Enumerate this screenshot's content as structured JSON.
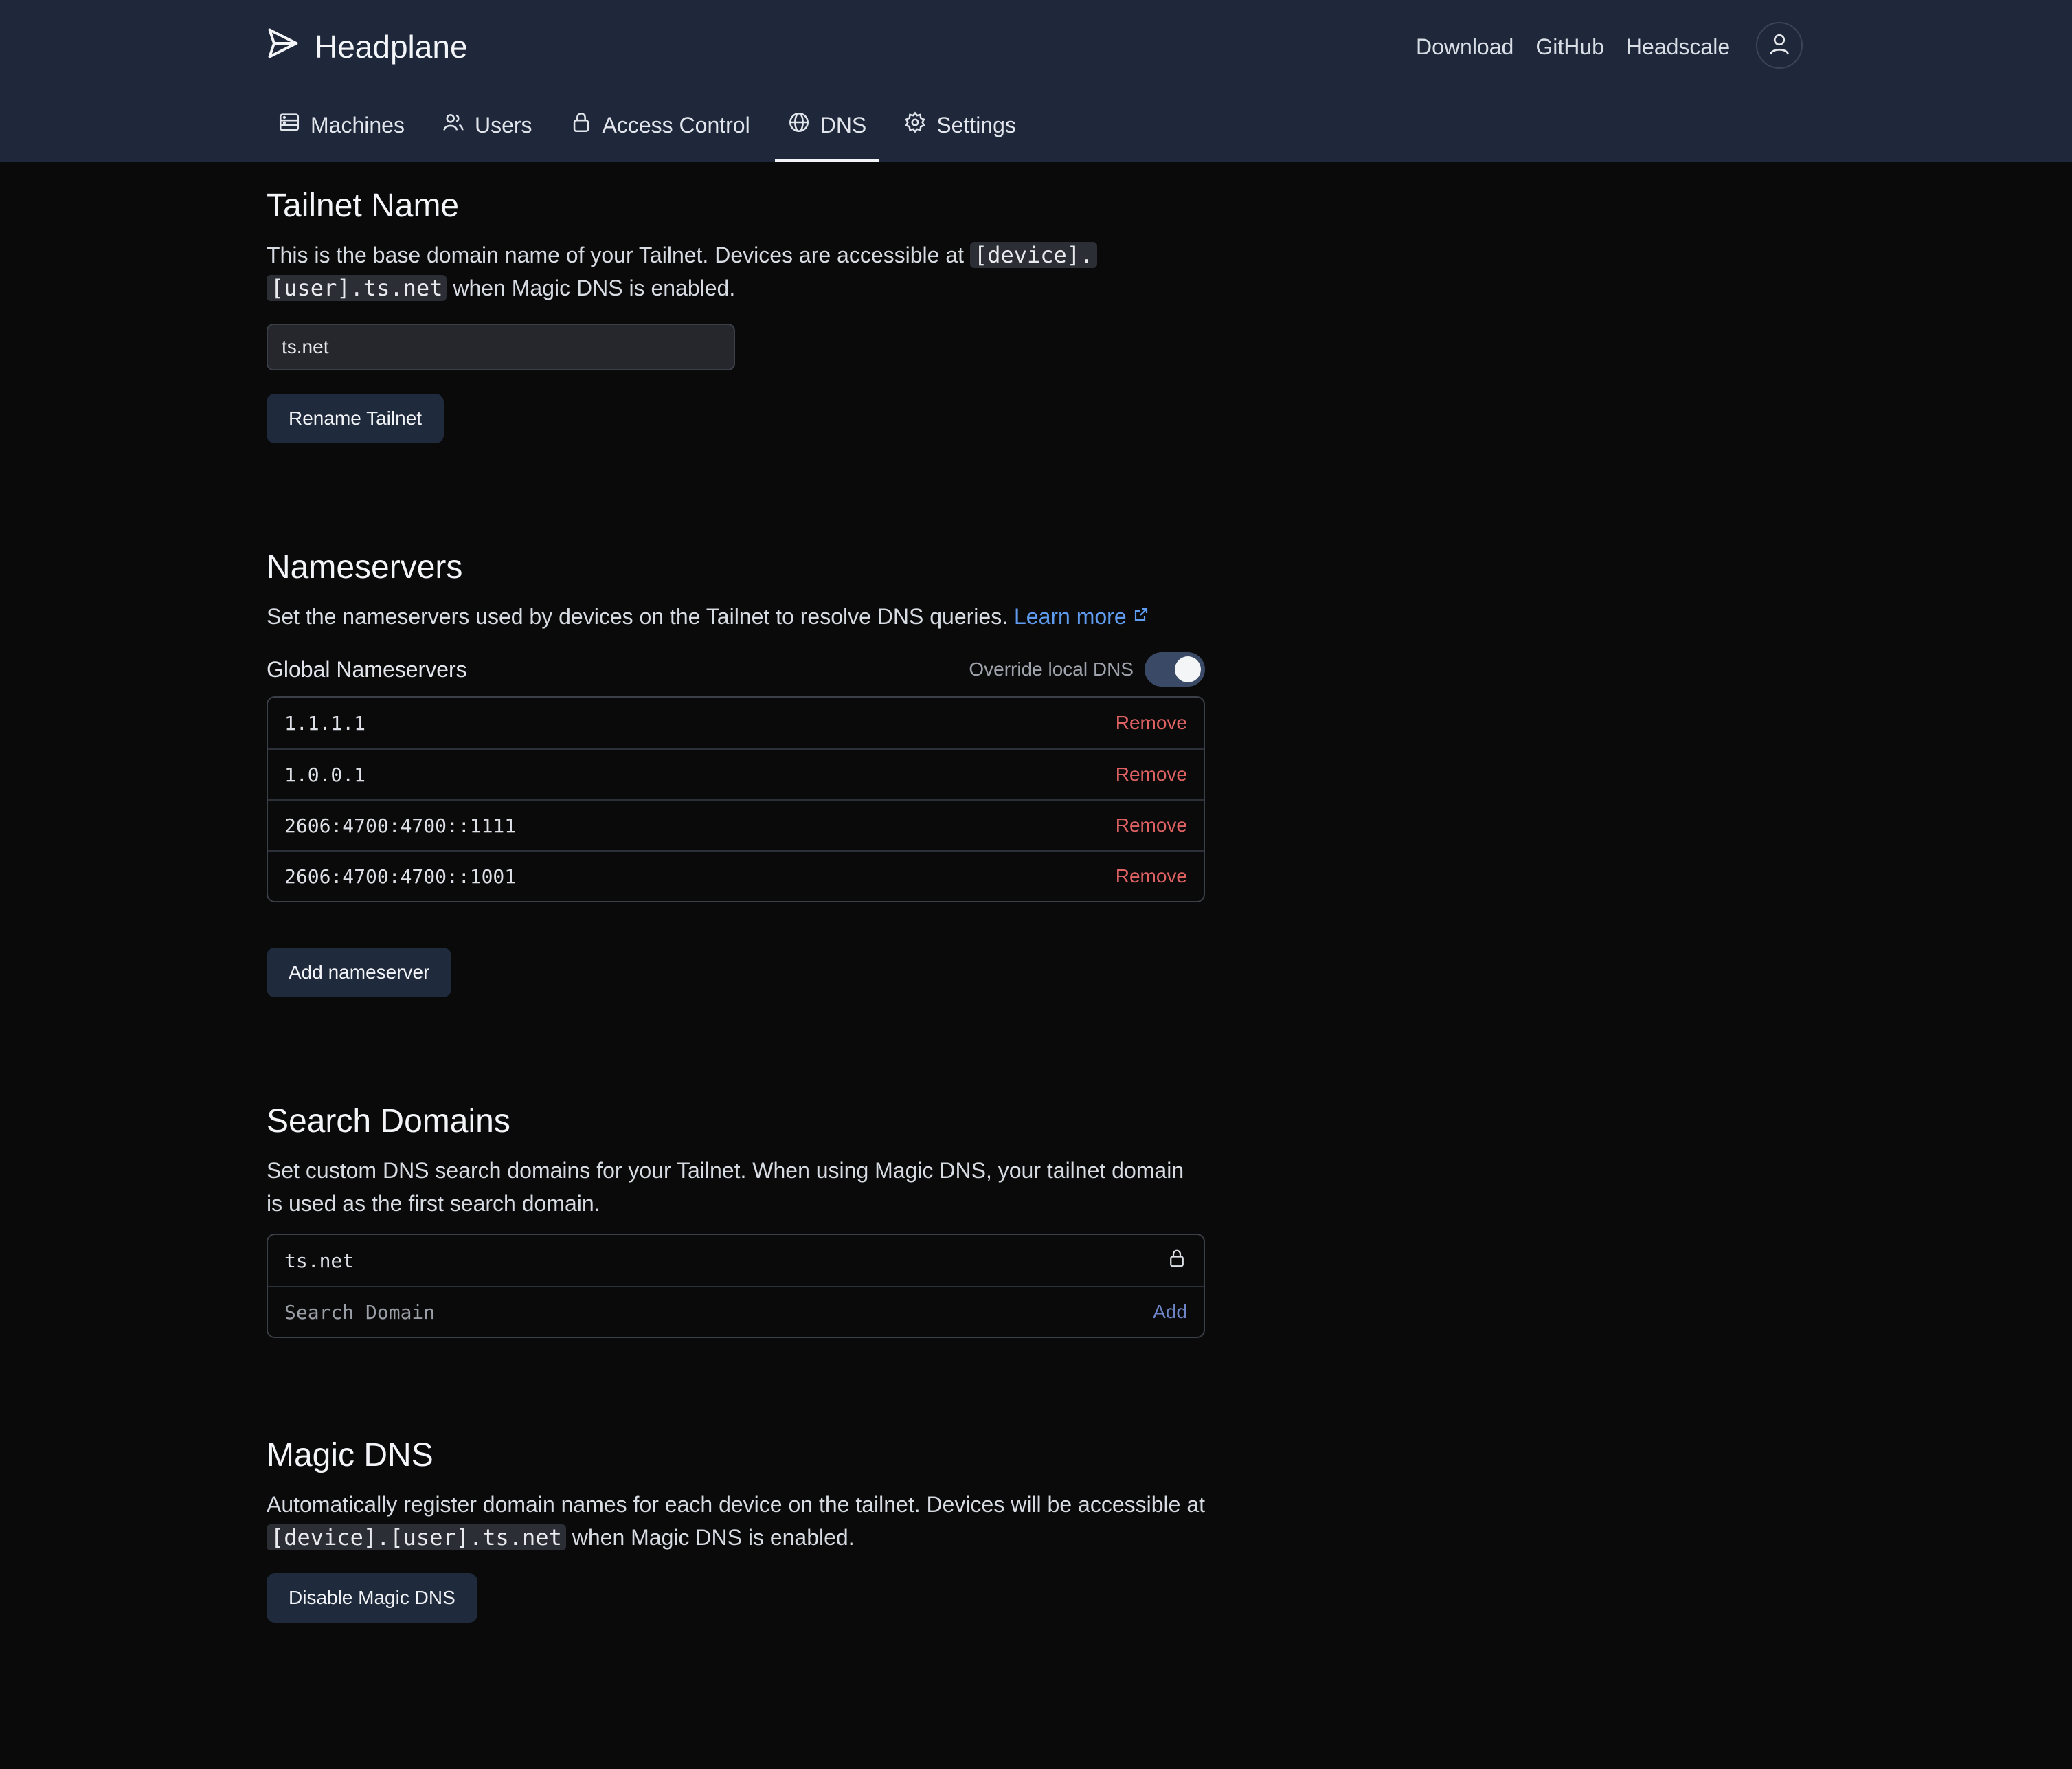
{
  "header": {
    "brand": "Headplane",
    "links": [
      "Download",
      "GitHub",
      "Headscale"
    ]
  },
  "tabs": [
    {
      "label": "Machines",
      "icon": "server-icon"
    },
    {
      "label": "Users",
      "icon": "users-icon"
    },
    {
      "label": "Access Control",
      "icon": "lock-icon"
    },
    {
      "label": "DNS",
      "icon": "globe-icon",
      "active": true
    },
    {
      "label": "Settings",
      "icon": "gear-icon"
    }
  ],
  "tailnet": {
    "title": "Tailnet Name",
    "desc_pre": "This is the base domain name of your Tailnet. Devices are accessible at",
    "code1": "[device].",
    "code2": "[user].ts.net",
    "desc_post": "when Magic DNS is enabled.",
    "input_value": "ts.net",
    "button": "Rename Tailnet"
  },
  "nameservers": {
    "title": "Nameservers",
    "desc": "Set the nameservers used by devices on the Tailnet to resolve DNS queries.",
    "learn_more": "Learn more",
    "global_label": "Global Nameservers",
    "override_label": "Override local DNS",
    "override_on": true,
    "items": [
      "1.1.1.1",
      "1.0.0.1",
      "2606:4700:4700::1111",
      "2606:4700:4700::1001"
    ],
    "remove_label": "Remove",
    "add_button": "Add nameserver"
  },
  "search_domains": {
    "title": "Search Domains",
    "desc": "Set custom DNS search domains for your Tailnet. When using Magic DNS, your tailnet domain is used as the first search domain.",
    "locked_domain": "ts.net",
    "placeholder": "Search Domain",
    "add_label": "Add"
  },
  "magic_dns": {
    "title": "Magic DNS",
    "desc_pre": "Automatically register domain names for each device on the tailnet. Devices will be accessible at",
    "code": "[device].[user].ts.net",
    "desc_post": "when Magic DNS is enabled.",
    "button": "Disable Magic DNS"
  }
}
